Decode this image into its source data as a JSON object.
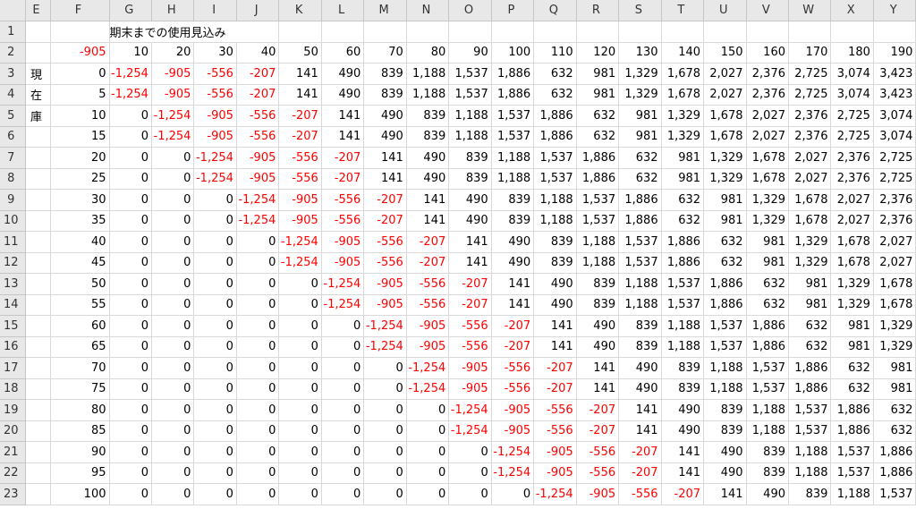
{
  "spreadsheet": {
    "columns": [
      "E",
      "F",
      "G",
      "H",
      "I",
      "J",
      "K",
      "L",
      "M",
      "N",
      "O",
      "P",
      "Q",
      "R",
      "S",
      "T",
      "U",
      "V",
      "W",
      "X",
      "Y"
    ],
    "title_row": 1,
    "title_col": "G",
    "title": "期末までの使用見込み",
    "neg_color": "#ff0000",
    "rows": [
      {
        "num": "1",
        "cells": [
          "",
          "",
          "",
          "",
          "",
          "",
          "",
          "",
          "",
          "",
          "",
          "",
          "",
          "",
          "",
          "",
          "",
          "",
          "",
          "",
          ""
        ]
      },
      {
        "num": "2",
        "cells": [
          "",
          "-905",
          "10",
          "20",
          "30",
          "40",
          "50",
          "60",
          "70",
          "80",
          "90",
          "100",
          "110",
          "120",
          "130",
          "140",
          "150",
          "160",
          "170",
          "180",
          "190"
        ]
      },
      {
        "num": "3",
        "cells": [
          "現",
          "0",
          "-1,254",
          "-905",
          "-556",
          "-207",
          "141",
          "490",
          "839",
          "1,188",
          "1,537",
          "1,886",
          "632",
          "981",
          "1,329",
          "1,678",
          "2,027",
          "2,376",
          "2,725",
          "3,074",
          "3,423"
        ]
      },
      {
        "num": "4",
        "cells": [
          "在",
          "5",
          "-1,254",
          "-905",
          "-556",
          "-207",
          "141",
          "490",
          "839",
          "1,188",
          "1,537",
          "1,886",
          "632",
          "981",
          "1,329",
          "1,678",
          "2,027",
          "2,376",
          "2,725",
          "3,074",
          "3,423"
        ]
      },
      {
        "num": "5",
        "cells": [
          "庫",
          "10",
          "0",
          "-1,254",
          "-905",
          "-556",
          "-207",
          "141",
          "490",
          "839",
          "1,188",
          "1,537",
          "1,886",
          "632",
          "981",
          "1,329",
          "1,678",
          "2,027",
          "2,376",
          "2,725",
          "3,074"
        ]
      },
      {
        "num": "6",
        "cells": [
          "",
          "15",
          "0",
          "-1,254",
          "-905",
          "-556",
          "-207",
          "141",
          "490",
          "839",
          "1,188",
          "1,537",
          "1,886",
          "632",
          "981",
          "1,329",
          "1,678",
          "2,027",
          "2,376",
          "2,725",
          "3,074"
        ]
      },
      {
        "num": "7",
        "cells": [
          "",
          "20",
          "0",
          "0",
          "-1,254",
          "-905",
          "-556",
          "-207",
          "141",
          "490",
          "839",
          "1,188",
          "1,537",
          "1,886",
          "632",
          "981",
          "1,329",
          "1,678",
          "2,027",
          "2,376",
          "2,725"
        ]
      },
      {
        "num": "8",
        "cells": [
          "",
          "25",
          "0",
          "0",
          "-1,254",
          "-905",
          "-556",
          "-207",
          "141",
          "490",
          "839",
          "1,188",
          "1,537",
          "1,886",
          "632",
          "981",
          "1,329",
          "1,678",
          "2,027",
          "2,376",
          "2,725"
        ]
      },
      {
        "num": "9",
        "cells": [
          "",
          "30",
          "0",
          "0",
          "0",
          "-1,254",
          "-905",
          "-556",
          "-207",
          "141",
          "490",
          "839",
          "1,188",
          "1,537",
          "1,886",
          "632",
          "981",
          "1,329",
          "1,678",
          "2,027",
          "2,376"
        ]
      },
      {
        "num": "10",
        "cells": [
          "",
          "35",
          "0",
          "0",
          "0",
          "-1,254",
          "-905",
          "-556",
          "-207",
          "141",
          "490",
          "839",
          "1,188",
          "1,537",
          "1,886",
          "632",
          "981",
          "1,329",
          "1,678",
          "2,027",
          "2,376"
        ]
      },
      {
        "num": "11",
        "cells": [
          "",
          "40",
          "0",
          "0",
          "0",
          "0",
          "-1,254",
          "-905",
          "-556",
          "-207",
          "141",
          "490",
          "839",
          "1,188",
          "1,537",
          "1,886",
          "632",
          "981",
          "1,329",
          "1,678",
          "2,027"
        ]
      },
      {
        "num": "12",
        "cells": [
          "",
          "45",
          "0",
          "0",
          "0",
          "0",
          "-1,254",
          "-905",
          "-556",
          "-207",
          "141",
          "490",
          "839",
          "1,188",
          "1,537",
          "1,886",
          "632",
          "981",
          "1,329",
          "1,678",
          "2,027"
        ]
      },
      {
        "num": "13",
        "cells": [
          "",
          "50",
          "0",
          "0",
          "0",
          "0",
          "0",
          "-1,254",
          "-905",
          "-556",
          "-207",
          "141",
          "490",
          "839",
          "1,188",
          "1,537",
          "1,886",
          "632",
          "981",
          "1,329",
          "1,678"
        ]
      },
      {
        "num": "14",
        "cells": [
          "",
          "55",
          "0",
          "0",
          "0",
          "0",
          "0",
          "-1,254",
          "-905",
          "-556",
          "-207",
          "141",
          "490",
          "839",
          "1,188",
          "1,537",
          "1,886",
          "632",
          "981",
          "1,329",
          "1,678"
        ]
      },
      {
        "num": "15",
        "cells": [
          "",
          "60",
          "0",
          "0",
          "0",
          "0",
          "0",
          "0",
          "-1,254",
          "-905",
          "-556",
          "-207",
          "141",
          "490",
          "839",
          "1,188",
          "1,537",
          "1,886",
          "632",
          "981",
          "1,329"
        ]
      },
      {
        "num": "16",
        "cells": [
          "",
          "65",
          "0",
          "0",
          "0",
          "0",
          "0",
          "0",
          "-1,254",
          "-905",
          "-556",
          "-207",
          "141",
          "490",
          "839",
          "1,188",
          "1,537",
          "1,886",
          "632",
          "981",
          "1,329"
        ]
      },
      {
        "num": "17",
        "cells": [
          "",
          "70",
          "0",
          "0",
          "0",
          "0",
          "0",
          "0",
          "0",
          "-1,254",
          "-905",
          "-556",
          "-207",
          "141",
          "490",
          "839",
          "1,188",
          "1,537",
          "1,886",
          "632",
          "981"
        ]
      },
      {
        "num": "18",
        "cells": [
          "",
          "75",
          "0",
          "0",
          "0",
          "0",
          "0",
          "0",
          "0",
          "-1,254",
          "-905",
          "-556",
          "-207",
          "141",
          "490",
          "839",
          "1,188",
          "1,537",
          "1,886",
          "632",
          "981"
        ]
      },
      {
        "num": "19",
        "cells": [
          "",
          "80",
          "0",
          "0",
          "0",
          "0",
          "0",
          "0",
          "0",
          "0",
          "-1,254",
          "-905",
          "-556",
          "-207",
          "141",
          "490",
          "839",
          "1,188",
          "1,537",
          "1,886",
          "632"
        ]
      },
      {
        "num": "20",
        "cells": [
          "",
          "85",
          "0",
          "0",
          "0",
          "0",
          "0",
          "0",
          "0",
          "0",
          "-1,254",
          "-905",
          "-556",
          "-207",
          "141",
          "490",
          "839",
          "1,188",
          "1,537",
          "1,886",
          "632"
        ]
      },
      {
        "num": "21",
        "cells": [
          "",
          "90",
          "0",
          "0",
          "0",
          "0",
          "0",
          "0",
          "0",
          "0",
          "0",
          "-1,254",
          "-905",
          "-556",
          "-207",
          "141",
          "490",
          "839",
          "1,188",
          "1,537",
          "1,886"
        ]
      },
      {
        "num": "22",
        "cells": [
          "",
          "95",
          "0",
          "0",
          "0",
          "0",
          "0",
          "0",
          "0",
          "0",
          "0",
          "-1,254",
          "-905",
          "-556",
          "-207",
          "141",
          "490",
          "839",
          "1,188",
          "1,537",
          "1,886"
        ]
      },
      {
        "num": "23",
        "cells": [
          "",
          "100",
          "0",
          "0",
          "0",
          "0",
          "0",
          "0",
          "0",
          "0",
          "0",
          "0",
          "-1,254",
          "-905",
          "-556",
          "-207",
          "141",
          "490",
          "839",
          "1,188",
          "1,537"
        ]
      }
    ]
  }
}
